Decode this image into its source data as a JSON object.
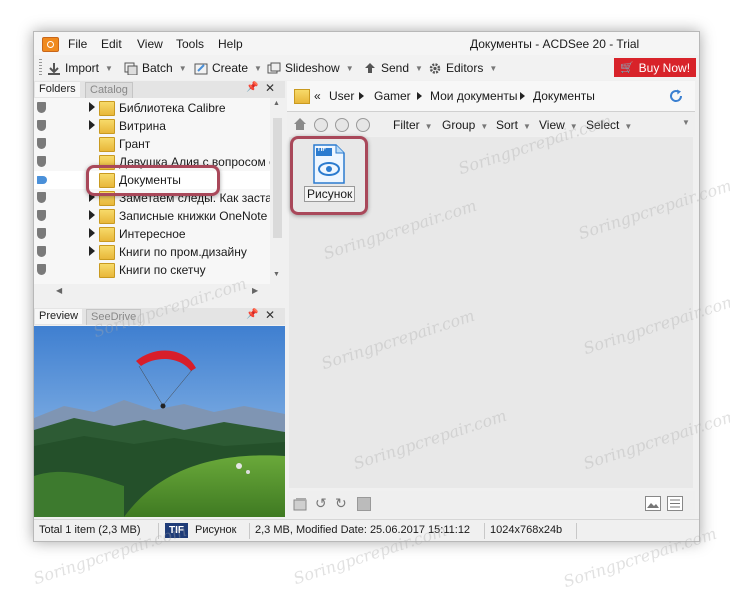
{
  "window": {
    "title": "Документы - ACDSee 20 - Trial",
    "menu": [
      "File",
      "Edit",
      "View",
      "Tools",
      "Help"
    ]
  },
  "toolbar": {
    "import": "Import",
    "batch": "Batch",
    "create": "Create",
    "slideshow": "Slideshow",
    "send": "Send",
    "editors": "Editors",
    "buy_now": "Buy Now!"
  },
  "folders_pane": {
    "tab_active": "Folders",
    "tab_inactive": "Catalog",
    "items": [
      {
        "label": "Библиотека Calibre",
        "expandable": true
      },
      {
        "label": "Витрина",
        "expandable": true
      },
      {
        "label": "Грант",
        "expandable": false
      },
      {
        "label": "Девушка Алия с вопросом о",
        "expandable": false
      },
      {
        "label": "Документы",
        "expandable": false,
        "selected": true
      },
      {
        "label": "Заметаем следы. Как заста",
        "expandable": true
      },
      {
        "label": "Записные книжки OneNote",
        "expandable": true
      },
      {
        "label": "Интересное",
        "expandable": true
      },
      {
        "label": "Книги по пром.дизайну",
        "expandable": true
      },
      {
        "label": "Книги по скетчу",
        "expandable": false
      }
    ]
  },
  "preview_pane": {
    "tab_active": "Preview",
    "tab_inactive": "SeeDrive"
  },
  "address_bar": {
    "prefix": "«",
    "crumbs": [
      "User",
      "Gamer",
      "Мои документы",
      "Документы"
    ]
  },
  "filter_bar": {
    "items": [
      "Filter",
      "Group",
      "Sort",
      "View",
      "Select"
    ]
  },
  "files": [
    {
      "name": "Рисунок",
      "type_badge": "TIF"
    }
  ],
  "status_bar": {
    "total": "Total 1 item  (2,3 MB)",
    "file_type": "TIF",
    "file_name": "Рисунок",
    "file_info": "2,3 MB, Modified Date: 25.06.2017 15:11:12",
    "dimensions": "1024x768x24b"
  },
  "watermark": "Soringpcrepair.com",
  "colors": {
    "buy_now": "#d8232a",
    "annotation": "#a9485a",
    "tif_badge": "#1f3c78",
    "accent_blue": "#4a90d9"
  }
}
